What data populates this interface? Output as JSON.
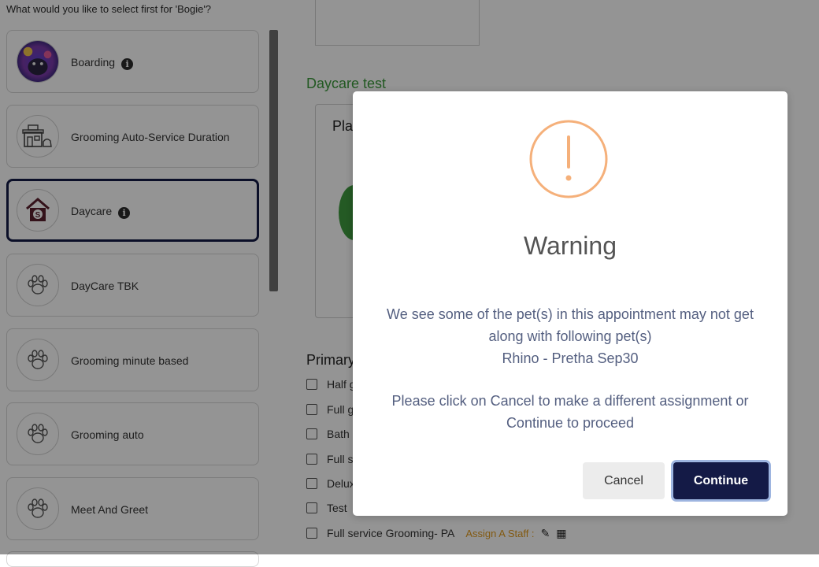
{
  "left_panel": {
    "prompt": "What would you like to select first for 'Bogie'?",
    "services": [
      {
        "label": "Boarding",
        "icon": "pet-photo",
        "info": true,
        "selected": false
      },
      {
        "label": "Grooming Auto-Service Duration",
        "icon": "grooming-shop-icon",
        "info": false,
        "selected": false
      },
      {
        "label": "Daycare",
        "icon": "daycare-house-icon",
        "info": true,
        "selected": true
      },
      {
        "label": "DayCare TBK",
        "icon": "paw-icon",
        "info": false,
        "selected": false
      },
      {
        "label": "Grooming minute based",
        "icon": "paw-icon",
        "info": false,
        "selected": false
      },
      {
        "label": "Grooming auto",
        "icon": "paw-icon",
        "info": false,
        "selected": false
      },
      {
        "label": "Meet And Greet",
        "icon": "paw-icon",
        "info": false,
        "selected": false
      }
    ]
  },
  "background": {
    "section_title": "Daycare test",
    "plan_label": "Pla",
    "primary_label": "Primary",
    "services": [
      {
        "label": "Half g"
      },
      {
        "label": "Full g"
      },
      {
        "label": "Bath"
      },
      {
        "label": "Full s"
      },
      {
        "label": "Delux"
      },
      {
        "label": "Test"
      },
      {
        "label": "Full service Grooming- PA",
        "assign": "Assign A Staff :"
      }
    ]
  },
  "modal": {
    "title": "Warning",
    "message_line1": "We see some of the pet(s) in this appointment may not get",
    "message_line2": "along with following pet(s)",
    "pet_names": "Rhino - Pretha Sep30",
    "instruction_line1": "Please click on Cancel to make a different assignment or",
    "instruction_line2": "Continue to proceed",
    "cancel_label": "Cancel",
    "continue_label": "Continue",
    "icon": "warning-exclamation-icon"
  },
  "colors": {
    "accent": "#141a46",
    "warning_icon": "#f5b07a",
    "section_green": "#3b9a3b",
    "assign_orange": "#e09a1e"
  }
}
